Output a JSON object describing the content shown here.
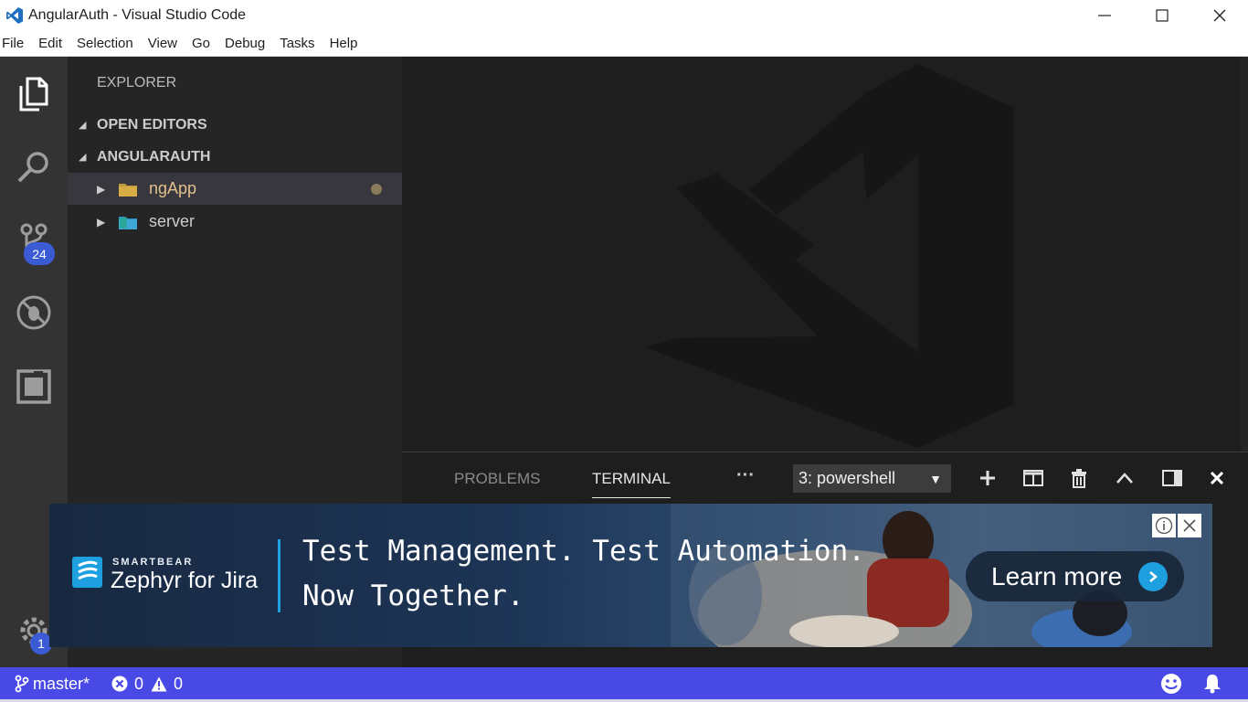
{
  "window": {
    "title": "AngularAuth - Visual Studio Code",
    "controls": [
      "minimize-icon",
      "maximize-icon",
      "close-icon"
    ]
  },
  "menu": [
    "File",
    "Edit",
    "Selection",
    "View",
    "Go",
    "Debug",
    "Tasks",
    "Help"
  ],
  "activity_bar": {
    "items": [
      "explorer-icon",
      "search-icon",
      "source-control-icon",
      "debug-icon",
      "extensions-icon"
    ],
    "source_control_badge": "24",
    "settings_badge": "1"
  },
  "sidebar": {
    "header": "EXPLORER",
    "open_editors": "OPEN EDITORS",
    "folder": "ANGULARAUTH",
    "tree": [
      {
        "name": "ngApp",
        "modified": true
      },
      {
        "name": "server",
        "modified": false
      }
    ]
  },
  "panel": {
    "tabs": [
      "PROBLEMS",
      "TERMINAL"
    ],
    "active_tab": "TERMINAL",
    "more": "···",
    "terminal_select": "3: powershell",
    "actions": [
      "add-terminal-icon",
      "split-terminal-icon",
      "kill-terminal-icon",
      "maximize-panel-icon",
      "toggle-panel-position-icon",
      "close-panel-icon"
    ]
  },
  "ad": {
    "brand_small": "SMARTBEAR",
    "brand": "Zephyr for Jira",
    "line1": "Test Management. Test Automation.",
    "line2": "Now Together.",
    "cta": "Learn more"
  },
  "statusbar": {
    "branch": "master*",
    "errors": "0",
    "warnings": "0"
  },
  "colors": {
    "statusbar": "#4949e6",
    "activitybar": "#333333",
    "sidebar": "#252526",
    "editor": "#1e1e1e",
    "folder_modified": "#e2c08d"
  }
}
